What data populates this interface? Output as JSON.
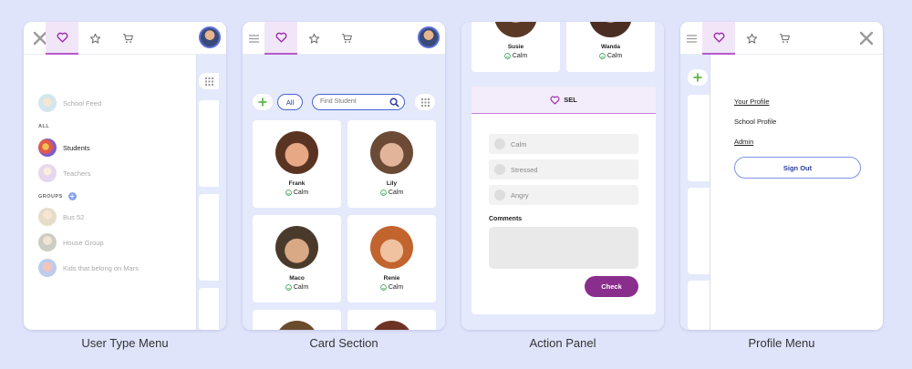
{
  "panels": {
    "user_type_menu": {
      "caption": "User Type Menu",
      "menu": {
        "school_feed": "School Feed",
        "all_label": "ALL",
        "students": "Students",
        "teachers": "Teachers",
        "groups_label": "GROUPS",
        "groups_add": "+",
        "groups": [
          "Bus 52",
          "House Group",
          "Kids that belong on Mars"
        ]
      }
    },
    "card_section": {
      "caption": "Card Section",
      "filter_label": "All",
      "search_placeholder": "Find Student",
      "students": [
        {
          "name": "Frank",
          "status": "Calm"
        },
        {
          "name": "Lily",
          "status": "Calm"
        },
        {
          "name": "Maco",
          "status": "Calm"
        },
        {
          "name": "Renie",
          "status": "Calm"
        }
      ]
    },
    "action_panel": {
      "caption": "Action Panel",
      "top_students": [
        {
          "name": "Susie",
          "status": "Calm"
        },
        {
          "name": "Wanda",
          "status": "Calm"
        }
      ],
      "sel_title": "SEL",
      "options": [
        "Calm",
        "Stressed",
        "Angry"
      ],
      "comments_label": "Comments",
      "check_button": "Check"
    },
    "profile_menu": {
      "caption": "Profile Menu",
      "links": {
        "your_profile": "Your Profile",
        "school_profile": "School Profile",
        "admin": "Admin"
      },
      "sign_out": "Sign Out"
    }
  },
  "colors": {
    "background": "#dfe4fb",
    "accent_purple": "#8a2e8e",
    "heart": "#9b2fae",
    "link_blue": "#2a3aa0",
    "calm_green": "#3aa557"
  }
}
